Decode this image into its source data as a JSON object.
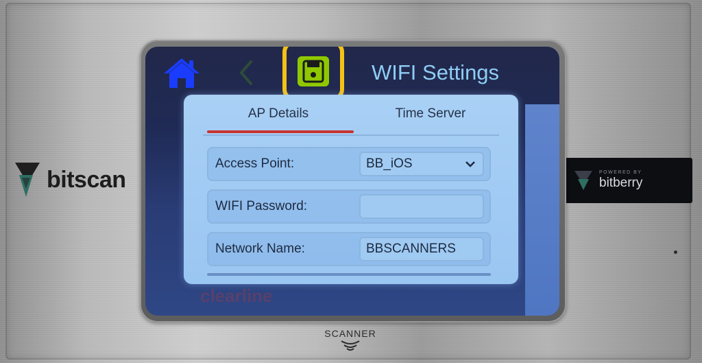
{
  "device": {
    "brand_left": "bitscan",
    "badge": {
      "powered_by": "POWERED BY",
      "name": "bitberry"
    },
    "scanner_label": "SCANNER",
    "screen_watermark": "clearline"
  },
  "header": {
    "title": "WIFI Settings",
    "icons": {
      "home": "home-icon",
      "back": "chevron-left-icon",
      "save": "floppy-disk-icon"
    },
    "colors": {
      "save": "#8fc800",
      "highlight": "#f5c116",
      "home": "#1a3cff",
      "title": "#8fcdf5"
    }
  },
  "tabs": [
    {
      "label": "AP Details",
      "active": true
    },
    {
      "label": "Time Server",
      "active": false
    }
  ],
  "rows": [
    {
      "label": "Access Point:",
      "value": "BB_iOS",
      "type": "dropdown"
    },
    {
      "label": "WIFI Password:",
      "value": "",
      "type": "text"
    },
    {
      "label": "Network Name:",
      "value": "BBSCANNERS",
      "type": "text"
    }
  ],
  "colors": {
    "tab_indicator": "#c8342e",
    "card": "#a9d0f5"
  }
}
